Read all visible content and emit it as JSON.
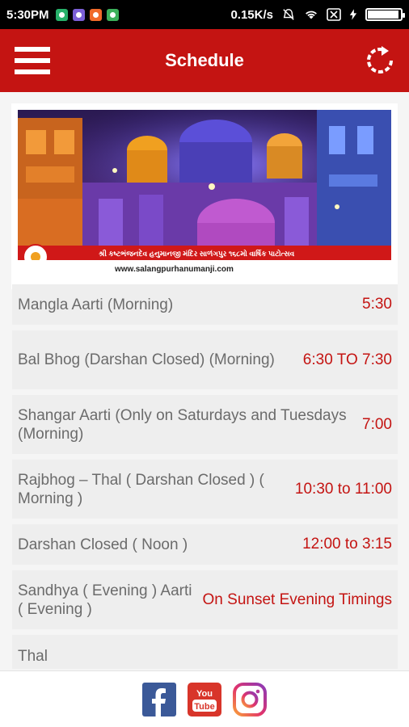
{
  "status_bar": {
    "time": "5:30PM",
    "network_speed": "0.15K/s",
    "battery_level": 0.95,
    "notification_icons": [
      "app-notification-icon-green",
      "app-notification-icon-purple",
      "app-notification-icon-orange",
      "app-notification-icon-green"
    ]
  },
  "header": {
    "title": "Schedule",
    "menu_icon": "hamburger-menu-icon",
    "refresh_icon": "refresh-icon",
    "background_color": "#c41412"
  },
  "banner": {
    "caption": "શ્રી કષ્ટભંજનદેવ હનુમાનજી મંદિર સાળંગપુર ૧૬૮મો વાર્ષિક પાટોત્સવ",
    "url": "www.salangpurhanumanji.com"
  },
  "schedule": [
    {
      "label": "Mangla Aarti (Morning)",
      "time": "5:30"
    },
    {
      "label": "Bal Bhog (Darshan Closed) (Morning)",
      "time": "6:30 TO 7:30"
    },
    {
      "label": "Shangar Aarti (Only on Saturdays and Tuesdays (Morning)",
      "time": "7:00"
    },
    {
      "label": "Rajbhog – Thal ( Darshan Closed ) ( Morning )",
      "time": "10:30 to 11:00"
    },
    {
      "label": "Darshan Closed ( Noon )",
      "time": "12:00 to 3:15"
    },
    {
      "label": "Sandhya ( Evening ) Aarti ( Evening )",
      "time": "On Sunset Evening Timings"
    },
    {
      "label": "Thal",
      "time": ""
    }
  ],
  "footer": {
    "facebook_icon": "facebook-icon",
    "youtube_icon": "youtube-icon",
    "youtube_text_top": "You",
    "youtube_text_bottom": "Tube",
    "instagram_icon": "instagram-icon"
  },
  "colors": {
    "accent": "#c41412",
    "row_background": "#eeeeee",
    "label_text": "#6b6b6b"
  }
}
